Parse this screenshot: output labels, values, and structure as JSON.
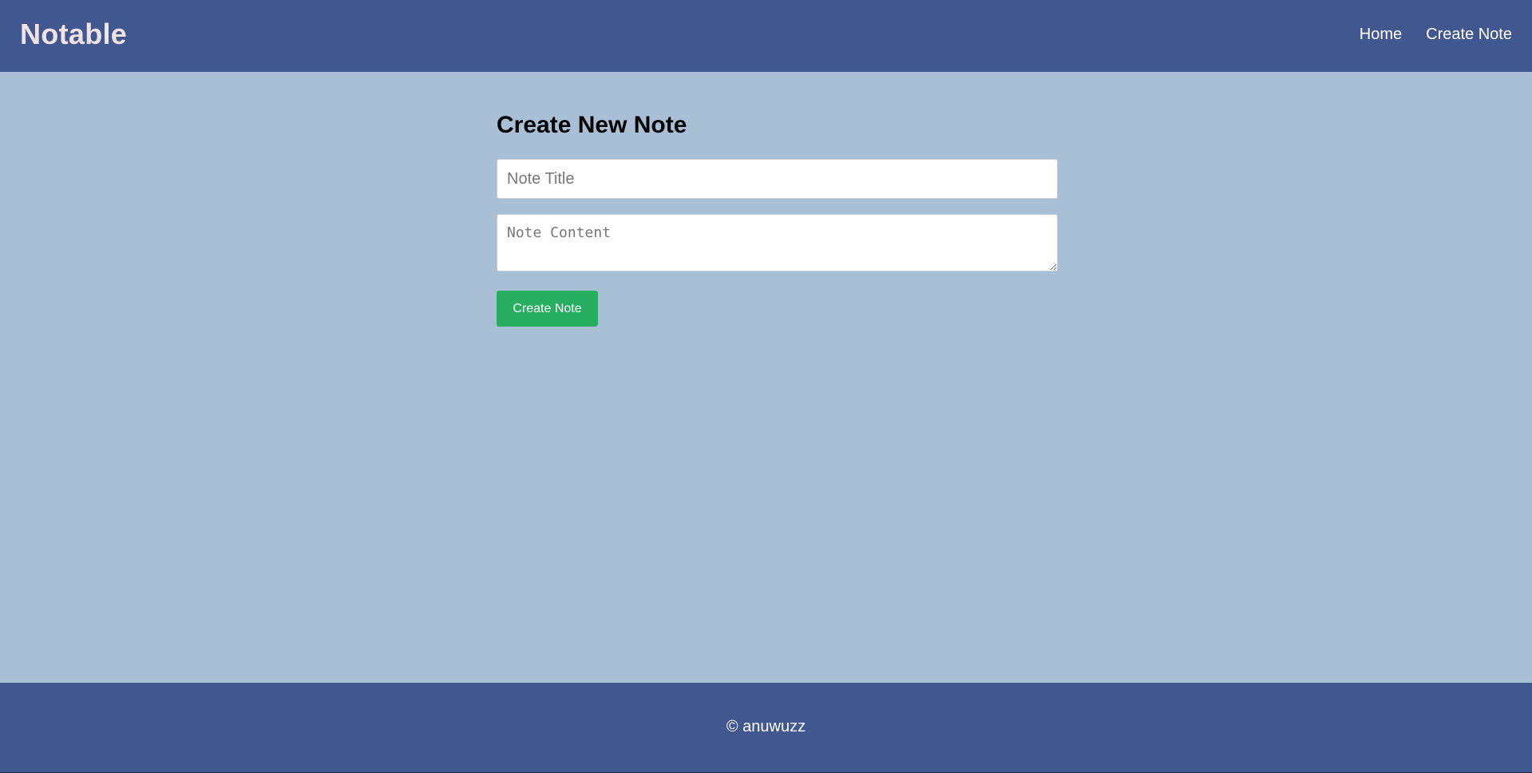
{
  "navbar": {
    "brand": "Notable",
    "links": [
      {
        "label": "Home"
      },
      {
        "label": "Create Note"
      }
    ]
  },
  "form": {
    "title": "Create New Note",
    "title_placeholder": "Note Title",
    "content_placeholder": "Note Content",
    "submit_label": "Create Note"
  },
  "footer": {
    "text": "© anuwuzz"
  },
  "colors": {
    "header_bg": "#40578f",
    "page_bg": "#a9bfd6",
    "brand_text": "#f1e2e6",
    "button_bg": "#27ae60"
  }
}
